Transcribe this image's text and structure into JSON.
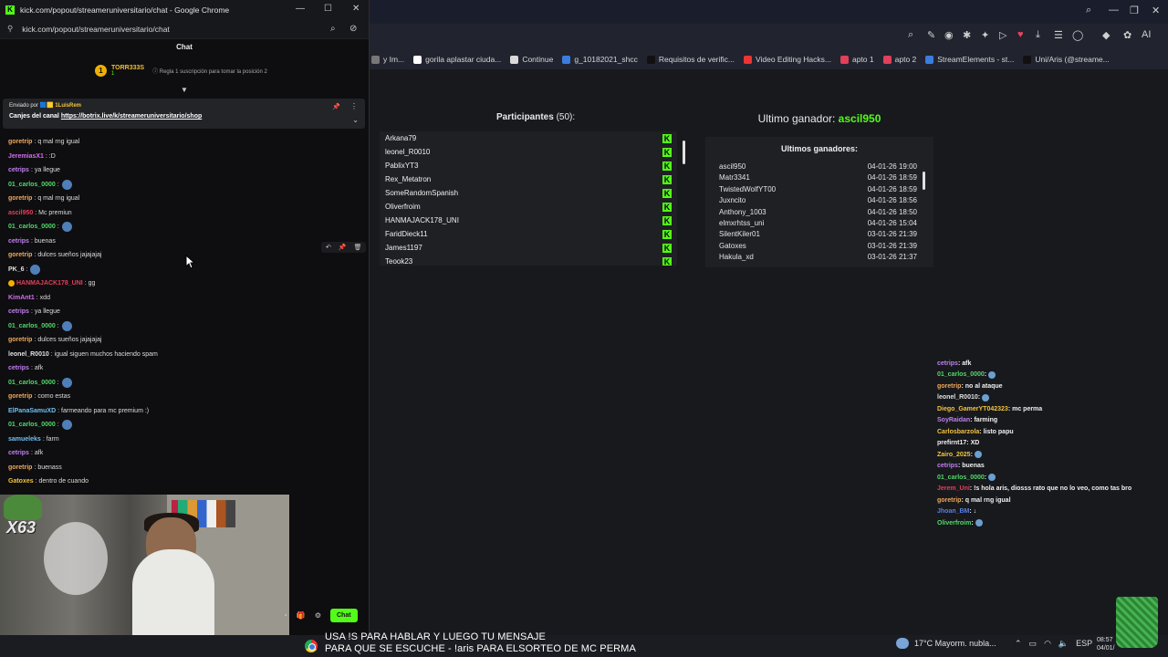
{
  "chat_window": {
    "title": "kick.com/popout/streameruniversitario/chat - Google Chrome",
    "url": "kick.com/popout/streameruniversitario/chat",
    "header": "Chat",
    "leader": {
      "name": "TORR333S",
      "count": "1",
      "rank": "1",
      "rule": "Regla 1 suscripción para tomar la posición 2"
    },
    "pinned": {
      "sent_by_prefix": "Enviado por",
      "sent_by_user": "1LuisRem",
      "message_prefix": "Canjes del canal",
      "message_link": "https://botrix.live/k/streameruniversitario/shop"
    },
    "messages": [
      {
        "user": "goretrip",
        "color": "#f2a85b",
        "text": ": q mal rng igual",
        "emote": false
      },
      {
        "user": "JeremiasX1",
        "color": "#d56ef0",
        "text": ": :D",
        "emote": false
      },
      {
        "user": "cetrips",
        "color": "#c07ef0",
        "text": ": ya llegue",
        "emote": false
      },
      {
        "user": "01_carlos_0000",
        "color": "#53d86a",
        "text": ":",
        "emote": true
      },
      {
        "user": "goretrip",
        "color": "#f2a85b",
        "text": ": q mal rng igual",
        "emote": false
      },
      {
        "user": "ascil950",
        "color": "#e0405a",
        "text": ": Mc premiun",
        "emote": false
      },
      {
        "user": "01_carlos_0000",
        "color": "#53d86a",
        "text": ":",
        "emote": true
      },
      {
        "user": "cetrips",
        "color": "#c07ef0",
        "text": ": buenas",
        "emote": false
      },
      {
        "user": "goretrip",
        "color": "#f2a85b",
        "text": ": dulces sueños jajajajaj",
        "emote": false
      },
      {
        "user": "PK_6",
        "color": "#e0e0e0",
        "text": ":",
        "emote": true
      },
      {
        "user": "HANMAJACK178_UNI",
        "color": "#e0405a",
        "text": ": gg",
        "emote": false,
        "badge": true
      },
      {
        "user": "KimAnt1",
        "color": "#d56ef0",
        "text": ": xdd",
        "emote": false
      },
      {
        "user": "cetrips",
        "color": "#c07ef0",
        "text": ": ya llegue",
        "emote": false
      },
      {
        "user": "01_carlos_0000",
        "color": "#53d86a",
        "text": ":",
        "emote": true
      },
      {
        "user": "goretrip",
        "color": "#f2a85b",
        "text": ": dulces sueños jajajajaj",
        "emote": false
      },
      {
        "user": "leonel_R0010",
        "color": "#e0e0e0",
        "text": ": igual siguen muchos haciendo spam",
        "emote": false
      },
      {
        "user": "cetrips",
        "color": "#c07ef0",
        "text": ": afk",
        "emote": false
      },
      {
        "user": "01_carlos_0000",
        "color": "#53d86a",
        "text": ":",
        "emote": true
      },
      {
        "user": "goretrip",
        "color": "#f2a85b",
        "text": ": como estas",
        "emote": false
      },
      {
        "user": "ElPanaSamuXD",
        "color": "#6fc0f0",
        "text": ": farmeando para mc premium :)",
        "emote": false
      },
      {
        "user": "01_carlos_0000",
        "color": "#53d86a",
        "text": ":",
        "emote": true
      },
      {
        "user": "samueleks",
        "color": "#6fc0f0",
        "text": ": farm",
        "emote": false
      },
      {
        "user": "cetrips",
        "color": "#c07ef0",
        "text": ": afk",
        "emote": false
      },
      {
        "user": "goretrip",
        "color": "#f2a85b",
        "text": ": buenass",
        "emote": false
      },
      {
        "user": "Gatoxes",
        "color": "#f2c53d",
        "text": ": dentro de cuando",
        "emote": false
      }
    ],
    "send_button": "Chat"
  },
  "bookmarks": [
    {
      "label": "y Im...",
      "color": "#777"
    },
    {
      "label": "gorila aplastar ciuda...",
      "color": "#ffffff"
    },
    {
      "label": "Continue",
      "color": "#d9d9d9"
    },
    {
      "label": "g_10182021_shcc",
      "color": "#3b7ddd"
    },
    {
      "label": "Requisitos de verific...",
      "color": "#111111"
    },
    {
      "label": "Video Editing Hacks...",
      "color": "#e33"
    },
    {
      "label": "apto 1",
      "color": "#e0405a"
    },
    {
      "label": "apto 2",
      "color": "#e0405a"
    },
    {
      "label": "StreamElements - st...",
      "color": "#3b7ddd"
    },
    {
      "label": "Uni/Aris (@streame...",
      "color": "#111111"
    }
  ],
  "participants": {
    "title": "Participantes",
    "count": "(50):",
    "names": [
      "Arkana79",
      "leonel_R0010",
      "PablixYT3",
      "Rex_Metatron",
      "SomeRandomSpanish",
      "Oliverfroim",
      "HANMAJACK178_UNI",
      "FaridDieck11",
      "James1197",
      "Teook23"
    ],
    "badge": "K"
  },
  "winners": {
    "title_prefix": "Ultimo ganador:",
    "last_winner": "ascil950",
    "subtitle": "Ultimos ganadores:",
    "rows": [
      {
        "name": "ascil950",
        "date": "04-01-26 19:00"
      },
      {
        "name": "Matr3341",
        "date": "04-01-26 18:59"
      },
      {
        "name": "TwistedWolfYT00",
        "date": "04-01-26 18:59"
      },
      {
        "name": "Juxncito",
        "date": "04-01-26 18:56"
      },
      {
        "name": "Anthony_1003",
        "date": "04-01-26 18:50"
      },
      {
        "name": "elmxrhtss_uni",
        "date": "04-01-26 15:04"
      },
      {
        "name": "SilentKiler01",
        "date": "03-01-26 21:39"
      },
      {
        "name": "Gatoxes",
        "date": "03-01-26 21:39"
      },
      {
        "name": "Hakula_xd",
        "date": "03-01-26 21:37"
      }
    ]
  },
  "overlay_chat": [
    {
      "user": "cetrips",
      "color": "#c07ef0",
      "text": " : afk"
    },
    {
      "user": "01_carlos_0000",
      "color": "#53d86a",
      "text": " :",
      "emote": true
    },
    {
      "user": "goretrip",
      "color": "#f2a85b",
      "text": " : no al ataque"
    },
    {
      "user": "leonel_R0010",
      "color": "#e0e0e0",
      "text": " :",
      "emote": true
    },
    {
      "user": "Diego_GamerYT042323",
      "color": "#f2c53d",
      "text": " : mc perma"
    },
    {
      "user": "SoyRaidan",
      "color": "#c07ef0",
      "text": " : farming"
    },
    {
      "user": "Carlosbarzola",
      "color": "#f2c53d",
      "text": " : listo papu"
    },
    {
      "user": "prefirnt17",
      "color": "#f0f0f0",
      "text": " : XD"
    },
    {
      "user": "Zairo_2025",
      "color": "#f2c53d",
      "text": " :",
      "emote": true
    },
    {
      "user": "cetrips",
      "color": "#c07ef0",
      "text": " : buenas"
    },
    {
      "user": "01_carlos_0000",
      "color": "#53d86a",
      "text": " :",
      "emote": true
    },
    {
      "user": "Jerem_Uni",
      "color": "#e0405a",
      "text": " : !s hola aris, diosss rato que no lo veo, como tas bro"
    },
    {
      "user": "goretrip",
      "color": "#f2a85b",
      "text": " : q mal rng igual"
    },
    {
      "user": "Jhoan_BM",
      "color": "#5b7fe0",
      "text": " : ↓"
    },
    {
      "user": "Oliverfroim",
      "color": "#53d86a",
      "text": " :",
      "emote": true
    }
  ],
  "webcam": {
    "overlay_text": "X63"
  },
  "caption": {
    "line1": "USA !S PARA HABLAR Y LUEGO TU MENSAJE",
    "line2": "PARA QUE SE ESCUCHE - !aris PARA ELSORTEO DE MC PERMA"
  },
  "taskbar": {
    "weather": "17°C  Mayorm. nubla...",
    "lang": "ESP",
    "time": "08:57",
    "date": "04/01/"
  }
}
